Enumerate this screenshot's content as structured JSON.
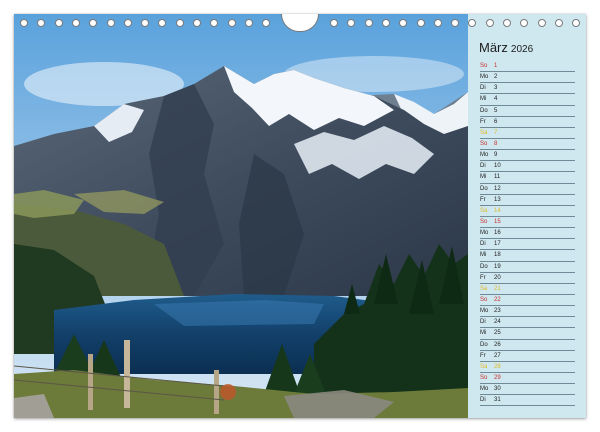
{
  "calendar": {
    "month": "März",
    "year": "2026",
    "days": [
      {
        "wd": "So",
        "d": "1",
        "type": "sun"
      },
      {
        "wd": "Mo",
        "d": "2",
        "type": "wk"
      },
      {
        "wd": "Di",
        "d": "3",
        "type": "wk"
      },
      {
        "wd": "Mi",
        "d": "4",
        "type": "wk"
      },
      {
        "wd": "Do",
        "d": "5",
        "type": "wk"
      },
      {
        "wd": "Fr",
        "d": "6",
        "type": "wk"
      },
      {
        "wd": "Sa",
        "d": "7",
        "type": "sat"
      },
      {
        "wd": "So",
        "d": "8",
        "type": "sun"
      },
      {
        "wd": "Mo",
        "d": "9",
        "type": "wk"
      },
      {
        "wd": "Di",
        "d": "10",
        "type": "wk"
      },
      {
        "wd": "Mi",
        "d": "11",
        "type": "wk"
      },
      {
        "wd": "Do",
        "d": "12",
        "type": "wk"
      },
      {
        "wd": "Fr",
        "d": "13",
        "type": "wk"
      },
      {
        "wd": "Sa",
        "d": "14",
        "type": "sat"
      },
      {
        "wd": "So",
        "d": "15",
        "type": "sun"
      },
      {
        "wd": "Mo",
        "d": "16",
        "type": "wk"
      },
      {
        "wd": "Di",
        "d": "17",
        "type": "wk"
      },
      {
        "wd": "Mi",
        "d": "18",
        "type": "wk"
      },
      {
        "wd": "Do",
        "d": "19",
        "type": "wk"
      },
      {
        "wd": "Fr",
        "d": "20",
        "type": "wk"
      },
      {
        "wd": "Sa",
        "d": "21",
        "type": "sat"
      },
      {
        "wd": "So",
        "d": "22",
        "type": "sun"
      },
      {
        "wd": "Mo",
        "d": "23",
        "type": "wk"
      },
      {
        "wd": "Di",
        "d": "24",
        "type": "wk"
      },
      {
        "wd": "Mi",
        "d": "25",
        "type": "wk"
      },
      {
        "wd": "Do",
        "d": "26",
        "type": "wk"
      },
      {
        "wd": "Fr",
        "d": "27",
        "type": "wk"
      },
      {
        "wd": "Sa",
        "d": "28",
        "type": "sat"
      },
      {
        "wd": "So",
        "d": "29",
        "type": "sun"
      },
      {
        "wd": "Mo",
        "d": "30",
        "type": "wk"
      },
      {
        "wd": "Di",
        "d": "31",
        "type": "wk"
      }
    ]
  },
  "colors": {
    "panel_bg": "#cfe8ef",
    "sunday": "#c62d2d",
    "saturday": "#e0b92a",
    "line": "#6f8a96"
  }
}
